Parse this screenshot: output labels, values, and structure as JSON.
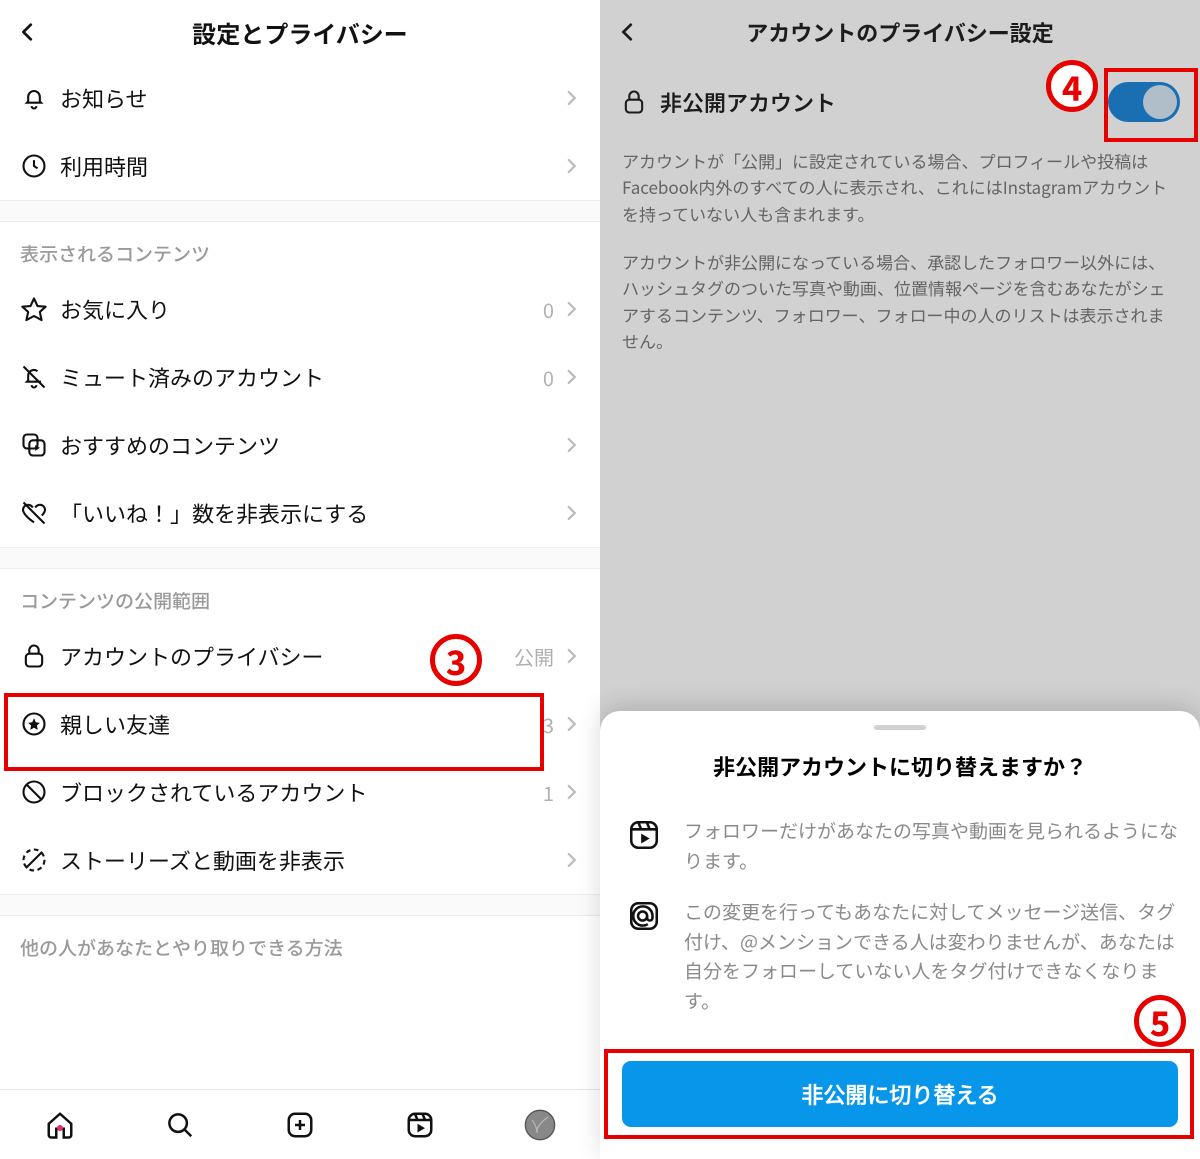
{
  "left": {
    "header": "設定とプライバシー",
    "row_notifications": "お知らせ",
    "row_usage": "利用時間",
    "section_content": "表示されるコンテンツ",
    "row_favorites": {
      "label": "お気に入り",
      "count": "0"
    },
    "row_muted": {
      "label": "ミュート済みのアカウント",
      "count": "0"
    },
    "row_suggested": "おすすめのコンテンツ",
    "row_hidelikes": "「いいね！」数を非表示にする",
    "section_scope": "コンテンツの公開範囲",
    "row_privacy": {
      "label": "アカウントのプライバシー",
      "value": "公開"
    },
    "row_closefriends": {
      "label": "親しい友達",
      "count": "3"
    },
    "row_blocked": {
      "label": "ブロックされているアカウント",
      "count": "1"
    },
    "row_hidestory": "ストーリーズと動画を非表示",
    "section_interaction": "他の人があなたとやり取りできる方法"
  },
  "right": {
    "header": "アカウントのプライバシー設定",
    "toggle_label": "非公開アカウント",
    "desc1": "アカウントが「公開」に設定されている場合、プロフィールや投稿はFacebook内外のすべての人に表示され、これにはInstagramアカウントを持っていない人も含まれます。",
    "desc2": "アカウントが非公開になっている場合、承認したフォロワー以外には、ハッシュタグのついた写真や動画、位置情報ページを含むあなたがシェアするコンテンツ、フォロワー、フォロー中の人のリストは表示されません。"
  },
  "sheet": {
    "title": "非公開アカウントに切り替えますか？",
    "bullet1": "フォロワーだけがあなたの写真や動画を見られるようになります。",
    "bullet2": "この変更を行ってもあなたに対してメッセージ送信、タグ付け、@メンションできる人は変わりませんが、あなたは自分をフォローしていない人をタグ付けできなくなります。",
    "button": "非公開に切り替える"
  },
  "annot": {
    "b3": "3",
    "b4": "4",
    "b5": "5"
  }
}
